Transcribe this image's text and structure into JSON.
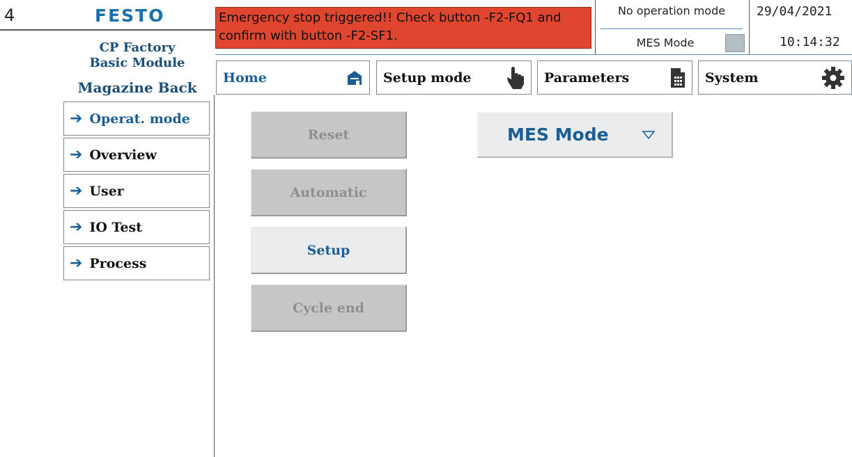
{
  "callout": {
    "number": "4"
  },
  "brand": {
    "logo_text": "FESTO"
  },
  "station": {
    "line1": "CP Factory",
    "line2": "Basic Module",
    "line3": "Magazine Back"
  },
  "header": {
    "alarm_message": "Emergency stop triggered!! Check button -F2-FQ1 and confirm with button -F2-SF1.",
    "alarm_color": "#e0452f",
    "operation_mode": "No operation mode",
    "mes_mode_label": "MES Mode",
    "date": "29/04/2021",
    "time": "10:14:32"
  },
  "nav": {
    "home": "Home",
    "setup_mode": "Setup mode",
    "parameters": "Parameters",
    "system": "System",
    "icons": [
      "home-icon",
      "hand-pointer-icon",
      "document-grid-icon",
      "gear-icon"
    ]
  },
  "sidebar": {
    "items": [
      {
        "label": "Operat. mode",
        "active": true
      },
      {
        "label": "Overview"
      },
      {
        "label": "User"
      },
      {
        "label": "IO Test"
      },
      {
        "label": "Process"
      }
    ]
  },
  "mode_buttons": {
    "reset": "Reset",
    "automatic": "Automatic",
    "setup": "Setup",
    "cycle_end": "Cycle end"
  },
  "mes_dropdown": {
    "selected": "MES Mode"
  },
  "colors": {
    "accent": "#1b5d96",
    "disabled_bg": "#c6c6c6",
    "brand": "#1a6fb0"
  }
}
